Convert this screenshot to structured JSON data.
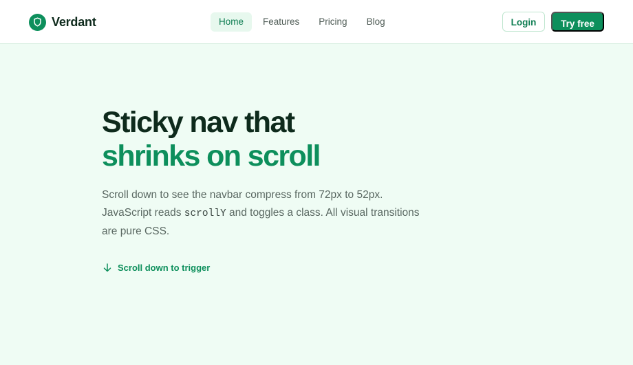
{
  "brand": {
    "name": "Verdant",
    "logo_icon": "shield-icon"
  },
  "nav": {
    "links": [
      {
        "label": "Home",
        "active": true
      },
      {
        "label": "Features",
        "active": false
      },
      {
        "label": "Pricing",
        "active": false
      },
      {
        "label": "Blog",
        "active": false
      }
    ],
    "login_label": "Login",
    "cta_label": "Try free"
  },
  "hero": {
    "title_line1": "Sticky nav that",
    "title_line2": "shrinks on scroll",
    "desc_part1": "Scroll down to see the navbar compress from 72px to 52px. JavaScript reads ",
    "desc_code": "scrollY",
    "desc_part2": " and toggles a class. All visual transitions are pure CSS.",
    "scroll_cue_label": "Scroll down to trigger",
    "scroll_cue_icon": "arrow-down-icon"
  },
  "colors": {
    "brand": "#0d8f5c",
    "heading": "#0e2a1c",
    "page_background": "#effcf4",
    "nav_active_background": "#e7f8ee"
  }
}
